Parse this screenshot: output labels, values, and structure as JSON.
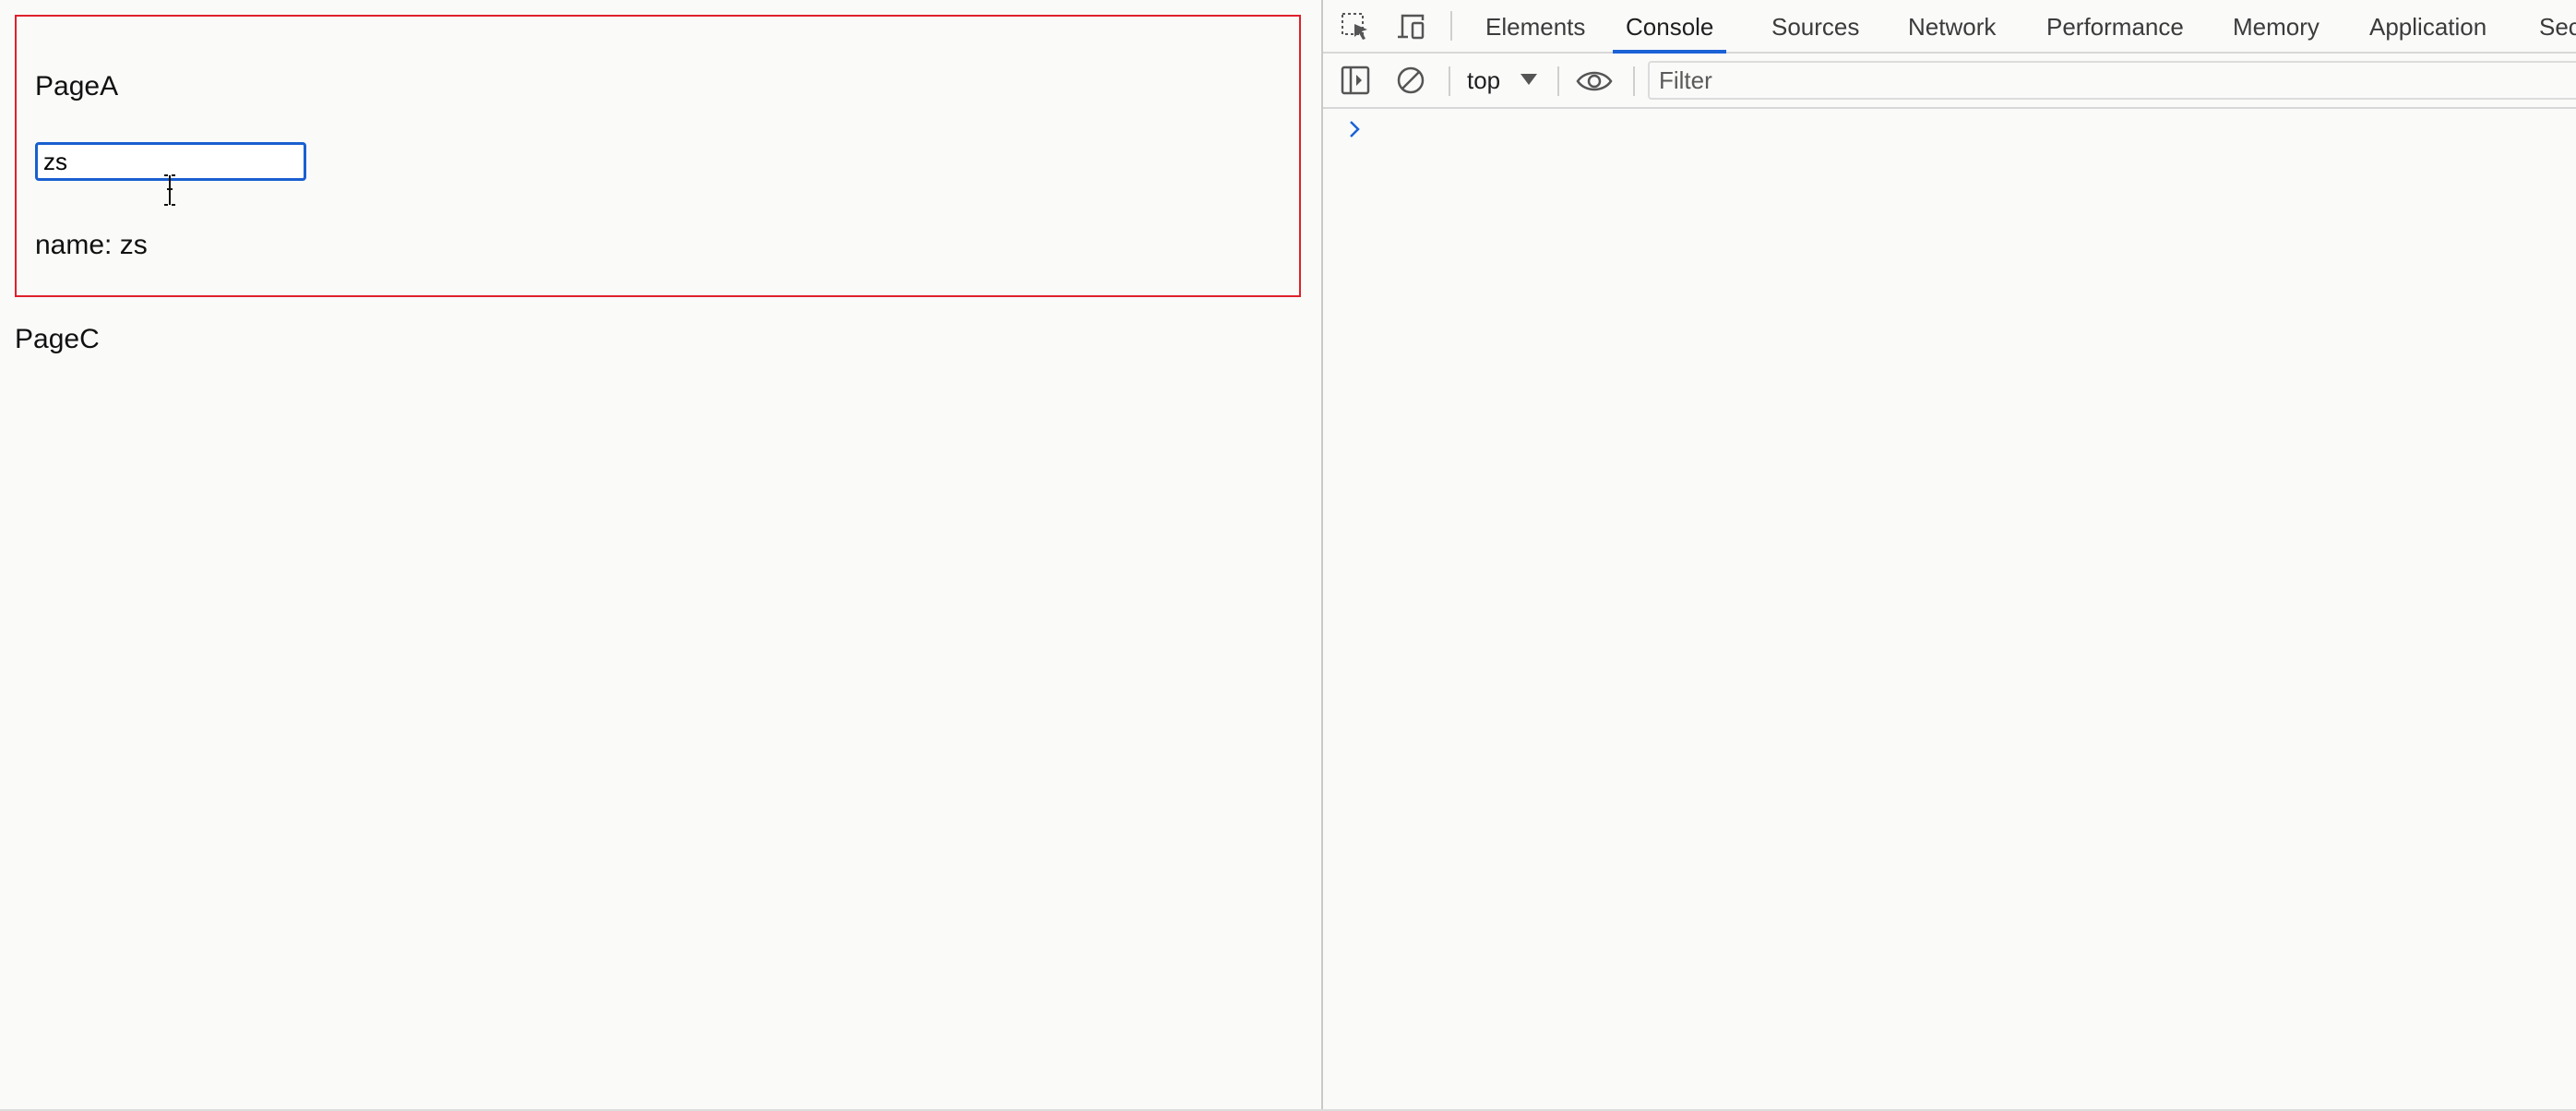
{
  "page": {
    "page_a": {
      "title": "PageA",
      "input_value": "zs",
      "name_label": "name: ",
      "name_value": "zs"
    },
    "page_c": {
      "title": "PageC"
    }
  },
  "devtools": {
    "toolbar_icons": [
      "inspect-element-icon",
      "device-toolbar-icon"
    ],
    "tabs": [
      {
        "label": "Elements",
        "active": false
      },
      {
        "label": "Console",
        "active": true
      },
      {
        "label": "Sources",
        "active": false
      },
      {
        "label": "Network",
        "active": false
      },
      {
        "label": "Performance",
        "active": false
      },
      {
        "label": "Memory",
        "active": false
      },
      {
        "label": "Application",
        "active": false
      },
      {
        "label": "Sec",
        "active": false
      }
    ],
    "console_toolbar": {
      "sidebar_icon": "sidebar-toggle-icon",
      "clear_icon": "clear-console-icon",
      "context": "top",
      "eye_icon": "live-expression-eye-icon",
      "filter_placeholder": "Filter"
    },
    "prompt_icon": "chevron-right-icon"
  },
  "colors": {
    "page_a_border": "#e0202a",
    "input_focus": "#1a5fd0",
    "active_tab_underline": "#1a62d6",
    "prompt": "#1a62d6"
  }
}
